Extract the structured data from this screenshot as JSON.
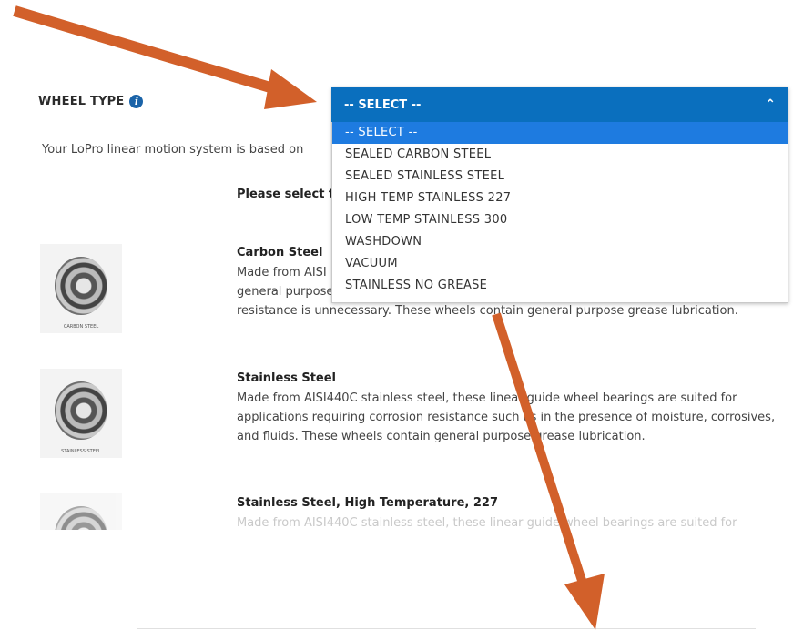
{
  "wheel_type": {
    "label": "WHEEL TYPE",
    "info_icon": "i"
  },
  "intro_text": "Your LoPro linear motion system is based on",
  "please_text": "Please select t",
  "dropdown": {
    "selected": "-- SELECT --",
    "options": [
      "-- SELECT --",
      "SEALED CARBON STEEL",
      "SEALED STAINLESS STEEL",
      "HIGH TEMP STAINLESS 227",
      "LOW TEMP STAINLESS 300",
      "WASHDOWN",
      "VACUUM",
      "STAINLESS NO GREASE"
    ]
  },
  "items": [
    {
      "title": "Carbon Steel",
      "line1": "Made from AISI",
      "line2": "general purpose",
      "line3": "resistance is unnecessary. These wheels contain general purpose grease lubrication.",
      "caption": "CARBON STEEL"
    },
    {
      "title": "Stainless Steel",
      "desc": "Made from AISI440C stainless steel, these linear guide wheel bearings are suited for applications requiring corrosion resistance such as in the presence of moisture, corrosives, and fluids. These wheels contain general purpose grease lubrication.",
      "caption": "STAINLESS STEEL"
    },
    {
      "title": "Stainless Steel, High Temperature, 227",
      "desc": "Made from AISI440C stainless steel, these linear guide wheel bearings are suited for"
    }
  ],
  "colors": {
    "dropdown_header": "#0a6fbe",
    "selected_option": "#1e7be0",
    "annotation_arrow": "#d2602a"
  }
}
